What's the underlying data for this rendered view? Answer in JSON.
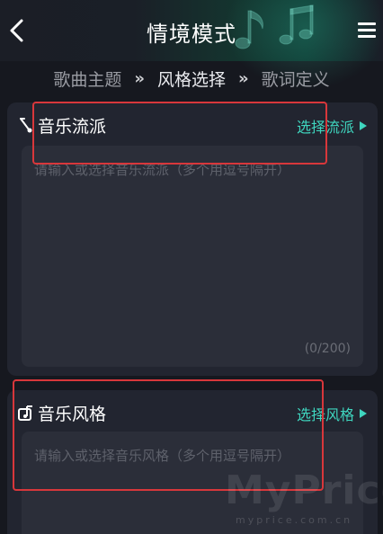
{
  "header": {
    "title": "情境模式"
  },
  "steps": [
    {
      "label": "歌曲主题"
    },
    {
      "label": "风格选择"
    },
    {
      "label": "歌词定义"
    }
  ],
  "step_separator": "»",
  "genre_card": {
    "title": "音乐流派",
    "link_label": "选择流派",
    "placeholder": "请输入或选择音乐流派（多个用逗号隔开）",
    "counter": "(0/200)"
  },
  "style_card": {
    "title": "音乐风格",
    "link_label": "选择风格",
    "placeholder": "请输入或选择音乐风格（多个用逗号隔开）"
  },
  "watermark": {
    "brand": "MyPrice",
    "domain": "myprice.com.cn"
  },
  "colors": {
    "background": "#16181f",
    "card": "#222530",
    "accent": "#3fd6bf",
    "annotation": "#d8373b"
  },
  "icons": {
    "back": "chevron-left-icon",
    "menu": "hamburger-menu-icon",
    "genre": "music-note-icon",
    "style": "music-box-icon",
    "link": "triangle-right-icon"
  }
}
